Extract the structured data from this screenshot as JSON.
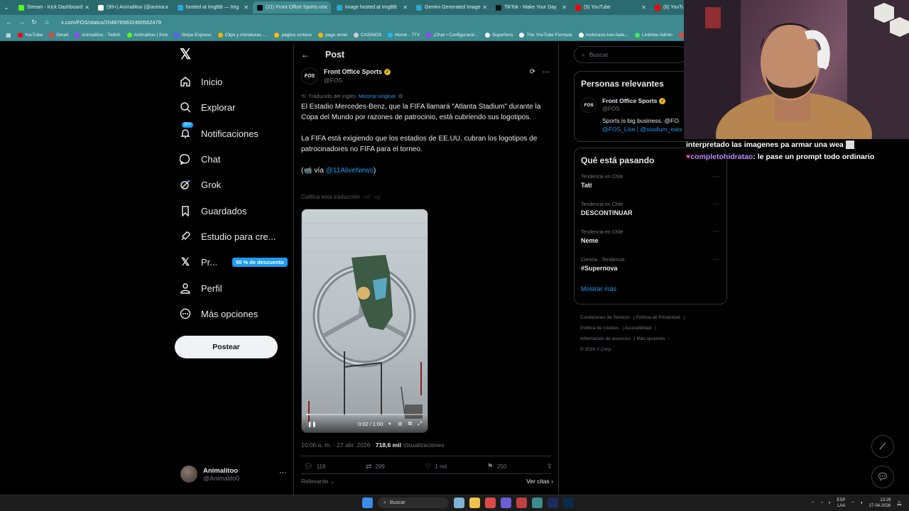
{
  "browser": {
    "tabs": [
      {
        "label": "Stream - Kick Dashboard",
        "color": "#53fc18",
        "active": false
      },
      {
        "label": "(99+) Animalitoo (@anima",
        "color": "#ffffff",
        "active": false
      },
      {
        "label": "hosted at ImgBB — Img",
        "color": "#2aa6d8",
        "active": false
      },
      {
        "label": "(21) Front Office Sports on",
        "color": "#000000",
        "active": true
      },
      {
        "label": "image hosted at ImgBB",
        "color": "#2aa6d8",
        "active": false
      },
      {
        "label": "Gemini Generated Image",
        "color": "#2aa6d8",
        "active": false
      },
      {
        "label": "TikTok - Make Your Day",
        "color": "#111111",
        "active": false
      },
      {
        "label": "(5) YouTube",
        "color": "#ff0000",
        "active": false
      },
      {
        "label": "(6) YouTube",
        "color": "#ff0000",
        "active": false
      }
    ],
    "url": "x.com/FOS/status/2048765632460562479",
    "bookmarks": [
      {
        "label": "YouTube",
        "color": "#ff0000"
      },
      {
        "label": "Gmail",
        "color": "#ea4335"
      },
      {
        "label": "Animalitoo - Twitch",
        "color": "#9146ff"
      },
      {
        "label": "Animalitoo | Kick",
        "color": "#53fc18"
      },
      {
        "label": "Stripe Express",
        "color": "#635bff"
      },
      {
        "label": "Clips y miniaturas -...",
        "color": "#f4b400"
      },
      {
        "label": "página sorteos",
        "color": "#fbbc05"
      },
      {
        "label": "pago ernel",
        "color": "#f4b400"
      },
      {
        "label": "CASINOS",
        "color": "#cfcfcf"
      },
      {
        "label": "Home - 7TV",
        "color": "#29b6f6"
      },
      {
        "label": "¡Chat • Configuració...",
        "color": "#9146ff"
      },
      {
        "label": "Superfans",
        "color": "#ffffff"
      },
      {
        "label": "The YouTube Formula",
        "color": "#ffffff"
      },
      {
        "label": "mohicano-low-fade...",
        "color": "#ffffff"
      },
      {
        "label": "Linktree Admin",
        "color": "#43e660"
      },
      {
        "label": "+ Cálculo de Bo",
        "color": "#ea4335"
      }
    ]
  },
  "nav": {
    "items": [
      {
        "label": "Inicio",
        "icon": "home-icon"
      },
      {
        "label": "Explorar",
        "icon": "search-icon"
      },
      {
        "label": "Notificaciones",
        "icon": "bell-icon"
      },
      {
        "label": "Chat",
        "icon": "chat-icon"
      },
      {
        "label": "Grok",
        "icon": "grok-icon"
      },
      {
        "label": "Guardados",
        "icon": "bookmark-icon"
      },
      {
        "label": "Estudio para cre...",
        "icon": "rocket-icon"
      },
      {
        "label": "Pr...",
        "icon": "x-premium-icon"
      },
      {
        "label": "Perfil",
        "icon": "person-icon"
      },
      {
        "label": "Más opciones",
        "icon": "more-circle-icon"
      }
    ],
    "notif_badge": "20+",
    "premium_promo": "50 % de descuento",
    "post_button": "Postear",
    "user_name": "Animalitoo",
    "user_handle": "@Animalito0"
  },
  "post": {
    "header_title": "Post",
    "author_name": "Front Office Sports",
    "author_handle": "@FOS",
    "avatar_text": "FOS",
    "translated_label": "Traducido del inglés",
    "show_original": "Mostrar original",
    "text_p1": "El Estadio Mercedes-Benz, que la FIFA llamará \"Atlanta Stadium\" durante la Copa del Mundo por razones de patrocinio, está cubriendo sus logotipos.",
    "text_p2": "La FIFA está exigiendo que los estadios de EE.UU. cubran los logotipos de patrocinadores no FIFA para el torneo.",
    "text_p3_prefix": "(📹 vía ",
    "text_p3_mention": "@11AliveNews",
    "text_p3_suffix": ")",
    "rate_translation": "Califica esta traducción",
    "video_time": "0:02 / 1:00",
    "video_progress": 0.033,
    "timestamp": "10:06 a. m. · 27 abr. 2026 · ",
    "views_count": "718,6 mil",
    "views_label": "Visualizaciones",
    "replies": "119",
    "reposts": "299",
    "likes": "1 mil",
    "bookmarks": "250",
    "sort_label": "Relevante",
    "quotes_label": "Ver citas"
  },
  "right": {
    "search_placeholder": "Buscar",
    "relevant_title": "Personas relevantes",
    "rel_name": "Front Office Sports",
    "rel_handle": "@FOS",
    "rel_bio_1": "Sports is big business. @FO",
    "rel_bio_2": "@FOS_Live | @stadium_eats",
    "trending_title": "Qué está pasando",
    "trends": [
      {
        "context": "Tendencia en Chile",
        "term": "Tati"
      },
      {
        "context": "Tendencia en Chile",
        "term": "DESCONTINUAR"
      },
      {
        "context": "Tendencia en Chile",
        "term": "Neme"
      },
      {
        "context": "Ciencia · Tendencia",
        "term": "#Supernova"
      }
    ],
    "show_more": "Mostrar más",
    "legal_1": "Condiciones de Servicio",
    "legal_2": "Política de Privacidad",
    "legal_3": "Política de cookies",
    "legal_4": "Accesibilidad",
    "legal_5": "Información de anuncios",
    "legal_6": "Más opciones ···",
    "legal_7": "© 2026 X Corp."
  },
  "overlay": {
    "chat_line_1": "interpretado las imagenes pa armar una wea",
    "chat_user": "completohidratao",
    "chat_line_2": ": le pase un prompt todo ordinario"
  },
  "taskbar": {
    "search": "Buscar",
    "lang_1": "ESP",
    "lang_2": "LAA",
    "time": "13:29",
    "date": "27-04-2026"
  }
}
